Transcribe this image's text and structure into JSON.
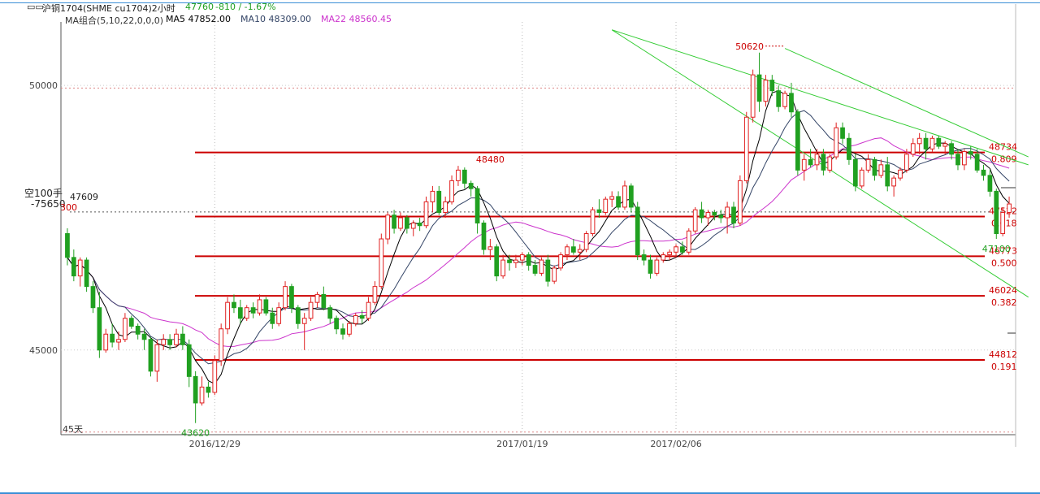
{
  "header": {
    "icon": "candlestick-window-icon",
    "symbol": "沪铜1704(SHME cu1704)2小时",
    "last_price": "47760",
    "change": "-810 / -1.67%",
    "ma_group": "MA组合(5,10,22,0,0,0)",
    "ma5": "MA5 47852.00",
    "ma10": "MA10 48309.00",
    "ma22": "MA22 48560.45"
  },
  "left_panel": {
    "position_label": "空100手",
    "position_value": "-75650",
    "partial_label": "300",
    "cursor_price": "47609",
    "period_label": "45天"
  },
  "colors": {
    "up": "#e02020",
    "down": "#20a020",
    "ma5": "#000000",
    "ma10": "#334466",
    "ma22": "#cc33cc",
    "fib": "#cc0000",
    "channel": "#33cc33"
  },
  "chart_data": {
    "type": "candlestick",
    "ylim": [
      43400,
      51200
    ],
    "yticks": [
      {
        "value": 50000,
        "label": "50000"
      },
      {
        "value": 45000,
        "label": "45000"
      }
    ],
    "xticks": [
      {
        "bar": 23,
        "label": "2016/12/29"
      },
      {
        "bar": 71,
        "label": "2017/01/19"
      },
      {
        "bar": 95,
        "label": "2017/02/06"
      }
    ],
    "annotations": [
      {
        "label": "50620",
        "bar": 112,
        "value": 50620,
        "color": "#cc0000"
      },
      {
        "label": "48480",
        "bar": 66,
        "value": 48480,
        "color": "#cc0000"
      },
      {
        "label": "43620",
        "bar": 20,
        "value": 43620,
        "color": "#20a020"
      },
      {
        "label": "47100",
        "bar": 145,
        "value": 47100,
        "color": "#20a020"
      }
    ],
    "fib_levels": [
      {
        "value": 48734,
        "ratio": "0.809"
      },
      {
        "value": 47522,
        "ratio": "0.618"
      },
      {
        "value": 46773,
        "ratio": "0.500"
      },
      {
        "value": 46024,
        "ratio": "0.382"
      },
      {
        "value": 44812,
        "ratio": "0.191"
      }
    ],
    "dotted_levels": [
      49950,
      47609,
      43450
    ],
    "channel": {
      "upper": [
        [
          85,
          51050
        ],
        [
          150,
          48500
        ]
      ],
      "lower": [
        [
          85,
          51050
        ],
        [
          150,
          46000
        ]
      ],
      "parallel": [
        [
          112,
          50700
        ],
        [
          150,
          48650
        ]
      ]
    },
    "ohlc": [
      [
        47200,
        47300,
        46600,
        46750
      ],
      [
        46750,
        46900,
        46300,
        46400
      ],
      [
        46400,
        46750,
        46200,
        46700
      ],
      [
        46700,
        46750,
        46100,
        46200
      ],
      [
        46200,
        46300,
        45700,
        45800
      ],
      [
        45800,
        46100,
        44850,
        45000
      ],
      [
        45000,
        45400,
        44950,
        45300
      ],
      [
        45300,
        45500,
        45050,
        45150
      ],
      [
        45150,
        45350,
        45000,
        45200
      ],
      [
        45200,
        45700,
        45150,
        45600
      ],
      [
        45600,
        45650,
        45400,
        45450
      ],
      [
        45450,
        45500,
        45200,
        45300
      ],
      [
        45300,
        45400,
        45000,
        45200
      ],
      [
        45200,
        45250,
        44500,
        44600
      ],
      [
        44600,
        45200,
        44400,
        45100
      ],
      [
        45100,
        45300,
        45000,
        45200
      ],
      [
        45200,
        45300,
        45000,
        45100
      ],
      [
        45100,
        45400,
        45050,
        45300
      ],
      [
        45300,
        45450,
        45000,
        45100
      ],
      [
        45100,
        45200,
        44300,
        44500
      ],
      [
        44500,
        44600,
        43620,
        44000
      ],
      [
        44000,
        44500,
        43950,
        44300
      ],
      [
        44300,
        44400,
        44100,
        44200
      ],
      [
        44200,
        44900,
        44150,
        44800
      ],
      [
        44800,
        45500,
        44700,
        45400
      ],
      [
        45400,
        46000,
        45300,
        45900
      ],
      [
        45900,
        46050,
        45700,
        45800
      ],
      [
        45800,
        45950,
        45500,
        45600
      ],
      [
        45600,
        45850,
        45550,
        45800
      ],
      [
        45800,
        45900,
        45600,
        45700
      ],
      [
        45700,
        46050,
        45650,
        45950
      ],
      [
        45950,
        46000,
        45650,
        45700
      ],
      [
        45700,
        45800,
        45400,
        45500
      ],
      [
        45500,
        45900,
        45450,
        45800
      ],
      [
        45800,
        46300,
        45750,
        46200
      ],
      [
        46200,
        46250,
        45700,
        45800
      ],
      [
        45800,
        45850,
        45400,
        45500
      ],
      [
        45500,
        45700,
        45000,
        45600
      ],
      [
        45600,
        46000,
        45550,
        45900
      ],
      [
        45900,
        46100,
        45800,
        46050
      ],
      [
        46050,
        46200,
        45750,
        45800
      ],
      [
        45800,
        45850,
        45500,
        45600
      ],
      [
        45600,
        45650,
        45300,
        45400
      ],
      [
        45400,
        45500,
        45200,
        45300
      ],
      [
        45300,
        45550,
        45250,
        45500
      ],
      [
        45500,
        45700,
        45450,
        45650
      ],
      [
        45650,
        45750,
        45500,
        45600
      ],
      [
        45600,
        46000,
        45550,
        45900
      ],
      [
        45900,
        46300,
        45850,
        46200
      ],
      [
        46200,
        47200,
        46150,
        47100
      ],
      [
        47100,
        47600,
        47000,
        47550
      ],
      [
        47550,
        47650,
        47200,
        47300
      ],
      [
        47300,
        47600,
        47250,
        47500
      ],
      [
        47500,
        47550,
        47200,
        47300
      ],
      [
        47300,
        47450,
        47150,
        47400
      ],
      [
        47400,
        47500,
        47250,
        47350
      ],
      [
        47350,
        47900,
        47300,
        47800
      ],
      [
        47800,
        48100,
        47600,
        48000
      ],
      [
        48000,
        48100,
        47550,
        47600
      ],
      [
        47600,
        47900,
        47500,
        47800
      ],
      [
        47800,
        48300,
        47750,
        48200
      ],
      [
        48200,
        48480,
        48100,
        48400
      ],
      [
        48400,
        48450,
        48050,
        48150
      ],
      [
        48150,
        48200,
        47900,
        48050
      ],
      [
        48050,
        48100,
        47200,
        47400
      ],
      [
        47400,
        47450,
        46800,
        46900
      ],
      [
        46900,
        47100,
        46700,
        46950
      ],
      [
        46950,
        47000,
        46300,
        46400
      ],
      [
        46400,
        46800,
        46350,
        46700
      ],
      [
        46700,
        46800,
        46500,
        46650
      ],
      [
        46650,
        46800,
        46550,
        46700
      ],
      [
        46700,
        46850,
        46600,
        46800
      ],
      [
        46800,
        46850,
        46500,
        46600
      ],
      [
        46600,
        46700,
        46400,
        46450
      ],
      [
        46450,
        46750,
        46400,
        46700
      ],
      [
        46700,
        46800,
        46200,
        46300
      ],
      [
        46300,
        46600,
        46250,
        46550
      ],
      [
        46550,
        46850,
        46500,
        46800
      ],
      [
        46800,
        47000,
        46700,
        46950
      ],
      [
        46950,
        47100,
        46800,
        46850
      ],
      [
        46850,
        47000,
        46700,
        46900
      ],
      [
        46900,
        47250,
        46850,
        47200
      ],
      [
        47200,
        47700,
        47150,
        47650
      ],
      [
        47650,
        47850,
        47500,
        47600
      ],
      [
        47600,
        47900,
        47550,
        47850
      ],
      [
        47850,
        48000,
        47700,
        47900
      ],
      [
        47900,
        48000,
        47650,
        47700
      ],
      [
        47700,
        48200,
        47650,
        48100
      ],
      [
        48100,
        48150,
        47600,
        47700
      ],
      [
        47700,
        47800,
        46700,
        46800
      ],
      [
        46800,
        46900,
        46600,
        46700
      ],
      [
        46700,
        46800,
        46350,
        46450
      ],
      [
        46450,
        46750,
        46400,
        46700
      ],
      [
        46700,
        46850,
        46650,
        46800
      ],
      [
        46800,
        46900,
        46700,
        46850
      ],
      [
        46850,
        47000,
        46750,
        46950
      ],
      [
        46950,
        47050,
        46800,
        46850
      ],
      [
        46850,
        47300,
        46800,
        47250
      ],
      [
        47250,
        47700,
        47200,
        47650
      ],
      [
        47650,
        47800,
        47400,
        47500
      ],
      [
        47500,
        47650,
        47350,
        47600
      ],
      [
        47600,
        47650,
        47450,
        47550
      ],
      [
        47550,
        47650,
        47400,
        47500
      ],
      [
        47500,
        47800,
        47200,
        47700
      ],
      [
        47700,
        47800,
        47300,
        47400
      ],
      [
        47400,
        48300,
        47350,
        48200
      ],
      [
        48200,
        49500,
        48150,
        49400
      ],
      [
        49400,
        50300,
        49300,
        50200
      ],
      [
        50200,
        50620,
        49500,
        49700
      ],
      [
        49700,
        50200,
        49600,
        50100
      ],
      [
        50100,
        50200,
        49800,
        49900
      ],
      [
        49900,
        50000,
        49500,
        49600
      ],
      [
        49600,
        49900,
        49550,
        49850
      ],
      [
        49850,
        50050,
        49400,
        49500
      ],
      [
        49500,
        49550,
        48300,
        48400
      ],
      [
        48400,
        48700,
        48200,
        48600
      ],
      [
        48600,
        48800,
        48450,
        48500
      ],
      [
        48500,
        48800,
        48400,
        48700
      ],
      [
        48700,
        48800,
        48300,
        48400
      ],
      [
        48400,
        48700,
        48350,
        48650
      ],
      [
        48650,
        49300,
        48600,
        49200
      ],
      [
        49200,
        49300,
        48900,
        49000
      ],
      [
        49000,
        49100,
        48500,
        48600
      ],
      [
        48600,
        48700,
        48000,
        48100
      ],
      [
        48100,
        48450,
        48050,
        48400
      ],
      [
        48400,
        48700,
        48350,
        48600
      ],
      [
        48600,
        48650,
        48200,
        48300
      ],
      [
        48300,
        48600,
        48250,
        48500
      ],
      [
        48500,
        48650,
        48000,
        48100
      ],
      [
        48100,
        48300,
        47900,
        48250
      ],
      [
        48250,
        48450,
        48200,
        48400
      ],
      [
        48400,
        48800,
        48350,
        48700
      ],
      [
        48700,
        49000,
        48650,
        48900
      ],
      [
        48900,
        49100,
        48700,
        49000
      ],
      [
        49000,
        49100,
        48600,
        48800
      ],
      [
        48800,
        49050,
        48750,
        49000
      ],
      [
        49000,
        49050,
        48800,
        48850
      ],
      [
        48850,
        48950,
        48700,
        48900
      ],
      [
        48900,
        48950,
        48600,
        48700
      ],
      [
        48700,
        48800,
        48400,
        48500
      ],
      [
        48500,
        48800,
        48400,
        48750
      ],
      [
        48750,
        48850,
        48600,
        48700
      ],
      [
        48700,
        48800,
        48350,
        48400
      ],
      [
        48400,
        48500,
        48200,
        48300
      ],
      [
        48300,
        48400,
        47900,
        48000
      ],
      [
        48000,
        48050,
        47100,
        47200
      ],
      [
        47200,
        47700,
        47150,
        47600
      ],
      [
        47600,
        47900,
        47500,
        47760
      ]
    ]
  }
}
